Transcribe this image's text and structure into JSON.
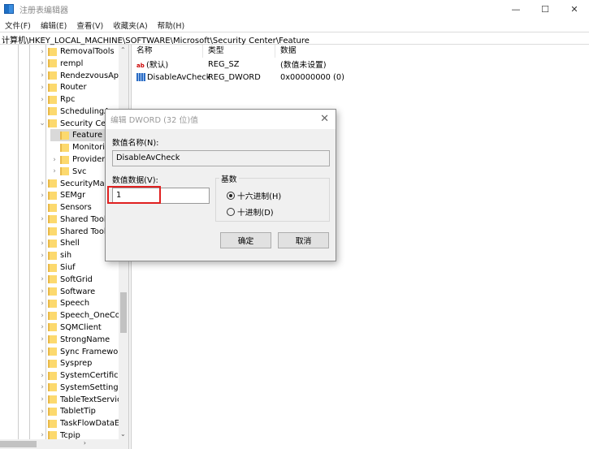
{
  "window": {
    "title": "注册表编辑器",
    "minimize": "—",
    "maximize": "☐",
    "close": "✕"
  },
  "menu": [
    "文件(F)",
    "编辑(E)",
    "查看(V)",
    "收藏夹(A)",
    "帮助(H)"
  ],
  "address": "计算机\\HKEY_LOCAL_MACHINE\\SOFTWARE\\Microsoft\\Security Center\\Feature",
  "tree": [
    {
      "label": "RemovalTools",
      "level": 0,
      "exp": ">"
    },
    {
      "label": "rempl",
      "level": 0,
      "exp": ">"
    },
    {
      "label": "RendezvousApp",
      "level": 0,
      "exp": ">"
    },
    {
      "label": "Router",
      "level": 0,
      "exp": ">"
    },
    {
      "label": "Rpc",
      "level": 0,
      "exp": ">"
    },
    {
      "label": "SchedulingAgent",
      "level": 0,
      "exp": ""
    },
    {
      "label": "Security Center",
      "level": 0,
      "exp": "v"
    },
    {
      "label": "Feature",
      "level": 1,
      "exp": "",
      "selected": true
    },
    {
      "label": "Monitoring",
      "level": 1,
      "exp": ""
    },
    {
      "label": "Provider",
      "level": 1,
      "exp": ">"
    },
    {
      "label": "Svc",
      "level": 1,
      "exp": ">"
    },
    {
      "label": "SecurityManager",
      "level": 0,
      "exp": ">"
    },
    {
      "label": "SEMgr",
      "level": 0,
      "exp": ">"
    },
    {
      "label": "Sensors",
      "level": 0,
      "exp": ""
    },
    {
      "label": "Shared Tools",
      "level": 0,
      "exp": ">"
    },
    {
      "label": "Shared Tools",
      "level": 0,
      "exp": ""
    },
    {
      "label": "Shell",
      "level": 0,
      "exp": ">"
    },
    {
      "label": "sih",
      "level": 0,
      "exp": ">"
    },
    {
      "label": "Siuf",
      "level": 0,
      "exp": ""
    },
    {
      "label": "SoftGrid",
      "level": 0,
      "exp": ">"
    },
    {
      "label": "Software",
      "level": 0,
      "exp": ">"
    },
    {
      "label": "Speech",
      "level": 0,
      "exp": ">"
    },
    {
      "label": "Speech_OneCore",
      "level": 0,
      "exp": ">"
    },
    {
      "label": "SQMClient",
      "level": 0,
      "exp": ">"
    },
    {
      "label": "StrongName",
      "level": 0,
      "exp": ">"
    },
    {
      "label": "Sync Framework",
      "level": 0,
      "exp": ">"
    },
    {
      "label": "Sysprep",
      "level": 0,
      "exp": ""
    },
    {
      "label": "SystemCertificates",
      "level": 0,
      "exp": ">"
    },
    {
      "label": "SystemSettings",
      "level": 0,
      "exp": ">"
    },
    {
      "label": "TableTextService",
      "level": 0,
      "exp": ">"
    },
    {
      "label": "TabletTip",
      "level": 0,
      "exp": ">"
    },
    {
      "label": "TaskFlowDataEngine",
      "level": 0,
      "exp": ""
    },
    {
      "label": "Tcpip",
      "level": 0,
      "exp": ">"
    }
  ],
  "list": {
    "headers": [
      "名称",
      "类型",
      "数据"
    ],
    "rows": [
      {
        "icon": "string-value-icon",
        "name": "(默认)",
        "type": "REG_SZ",
        "data": "(数值未设置)"
      },
      {
        "icon": "binary-value-icon",
        "name": "DisableAvCheck",
        "type": "REG_DWORD",
        "data": "0x00000000 (0)"
      }
    ]
  },
  "dialog": {
    "title": "编辑 DWORD (32 位)值",
    "name_label": "数值名称(N):",
    "name_value": "DisableAvCheck",
    "data_label": "数值数据(V):",
    "data_value": "1",
    "base_label": "基数",
    "hex_label": "十六进制(H)",
    "dec_label": "十进制(D)",
    "base_selected": "hex",
    "ok": "确定",
    "cancel": "取消",
    "highlight_color": "#e02020"
  }
}
